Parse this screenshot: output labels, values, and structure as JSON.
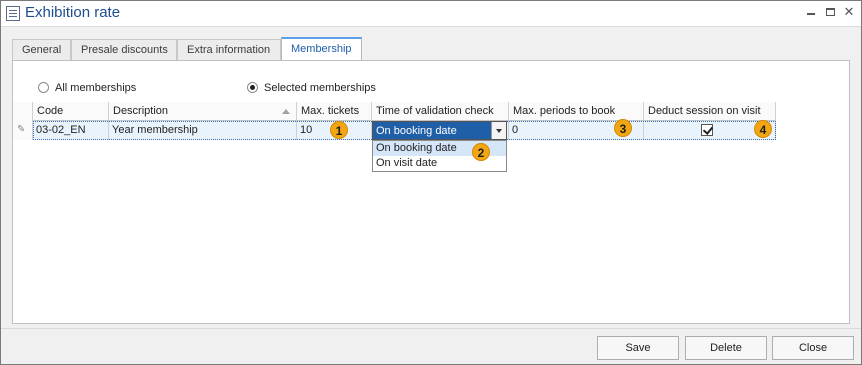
{
  "window": {
    "title": "Exhibition rate"
  },
  "tabs": [
    {
      "label": "General",
      "active": false
    },
    {
      "label": "Presale discounts",
      "active": false
    },
    {
      "label": "Extra information",
      "active": false
    },
    {
      "label": "Membership",
      "active": true
    }
  ],
  "membership_scope": {
    "options": [
      {
        "label": "All memberships",
        "checked": false
      },
      {
        "label": "Selected memberships",
        "checked": true
      }
    ]
  },
  "grid": {
    "columns": [
      {
        "label": "Code"
      },
      {
        "label": "Description"
      },
      {
        "label": "Max. tickets"
      },
      {
        "label": "Time of validation check"
      },
      {
        "label": "Max. periods to book"
      },
      {
        "label": "Deduct session on visit"
      }
    ],
    "rows": [
      {
        "code": "03-02_EN",
        "description": "Year membership",
        "max_tickets": "10",
        "time_of_validation_check": "On booking date",
        "max_periods_to_book": "0",
        "deduct_session_on_visit": true
      }
    ]
  },
  "validation_dropdown": {
    "options": [
      {
        "label": "On booking date",
        "highlighted": true
      },
      {
        "label": "On visit date",
        "highlighted": false
      }
    ]
  },
  "callouts": [
    "1",
    "2",
    "3",
    "4"
  ],
  "footer": {
    "save_label": "Save",
    "delete_label": "Delete",
    "close_label": "Close"
  },
  "colors": {
    "accent": "#1f5fa8",
    "callout": "#f2a614",
    "selected_row": "#e9f3fc"
  }
}
